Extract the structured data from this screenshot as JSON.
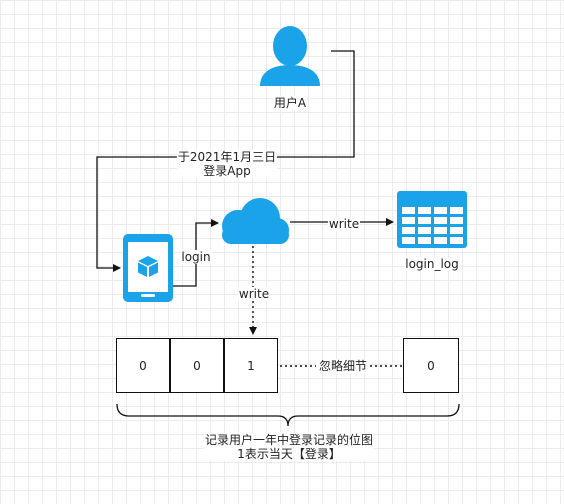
{
  "user": {
    "label": "用户A"
  },
  "login_event": {
    "line1": "于2021年1月三日",
    "line2": "登录App"
  },
  "edges": {
    "login": "login",
    "write_top": "write",
    "write_down": "write"
  },
  "storage": {
    "label": "login_log"
  },
  "bitmap": {
    "cells": [
      "0",
      "0",
      "1"
    ],
    "ellipsis": "忽略细节",
    "last_cell": "0"
  },
  "caption": {
    "line1": "记录用户一年中登录记录的位图",
    "line2": "1表示当天【登录】"
  },
  "colors": {
    "accent": "#1aa3e8",
    "line": "#111111"
  }
}
